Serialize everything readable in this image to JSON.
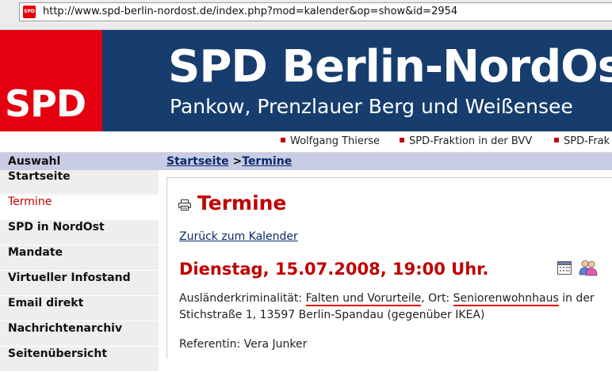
{
  "browser": {
    "url": "http://www.spd-berlin-nordost.de/index.php?mod=kalender&op=show&id=2954"
  },
  "banner": {
    "logo_text": "SPD",
    "title": "SPD Berlin-NordOst",
    "subtitle": "Pankow, Prenzlauer Berg und Weißensee"
  },
  "topnav": {
    "items": [
      "Wolfgang Thierse",
      "SPD-Fraktion in der BVV",
      "SPD-Frak"
    ]
  },
  "sidebar": {
    "header": "Auswahl",
    "items": [
      {
        "label": "Startseite"
      },
      {
        "label": "Termine"
      },
      {
        "label": "SPD in NordOst"
      },
      {
        "label": "Mandate"
      },
      {
        "label": "Virtueller Infostand"
      },
      {
        "label": "Email direkt"
      },
      {
        "label": "Nachrichtenarchiv"
      },
      {
        "label": "Seitenübersicht"
      }
    ]
  },
  "breadcrumb": {
    "home": "Startseite",
    "separator": " >",
    "current": "Termine"
  },
  "content": {
    "title": "Termine",
    "back_link": "Zurück zum Kalender",
    "date": "Dienstag, 15.07.2008, 19:00 Uhr.",
    "desc_prefix": "Ausländerkriminalität: ",
    "desc_topic": "Falten und Vorurteile",
    "desc_mid": ", Ort: ",
    "desc_place": "Seniorenwohnhaus",
    "desc_suffix": " in der Stichstraße 1, 13597 Berlin-Spandau (gegenüber IKEA)",
    "speaker": "Referentin: Vera Junker"
  },
  "colors": {
    "spd_red": "#e3000f",
    "banner_blue": "#163d6d",
    "title_red": "#c00000",
    "link_blue": "#0a2a6a"
  }
}
